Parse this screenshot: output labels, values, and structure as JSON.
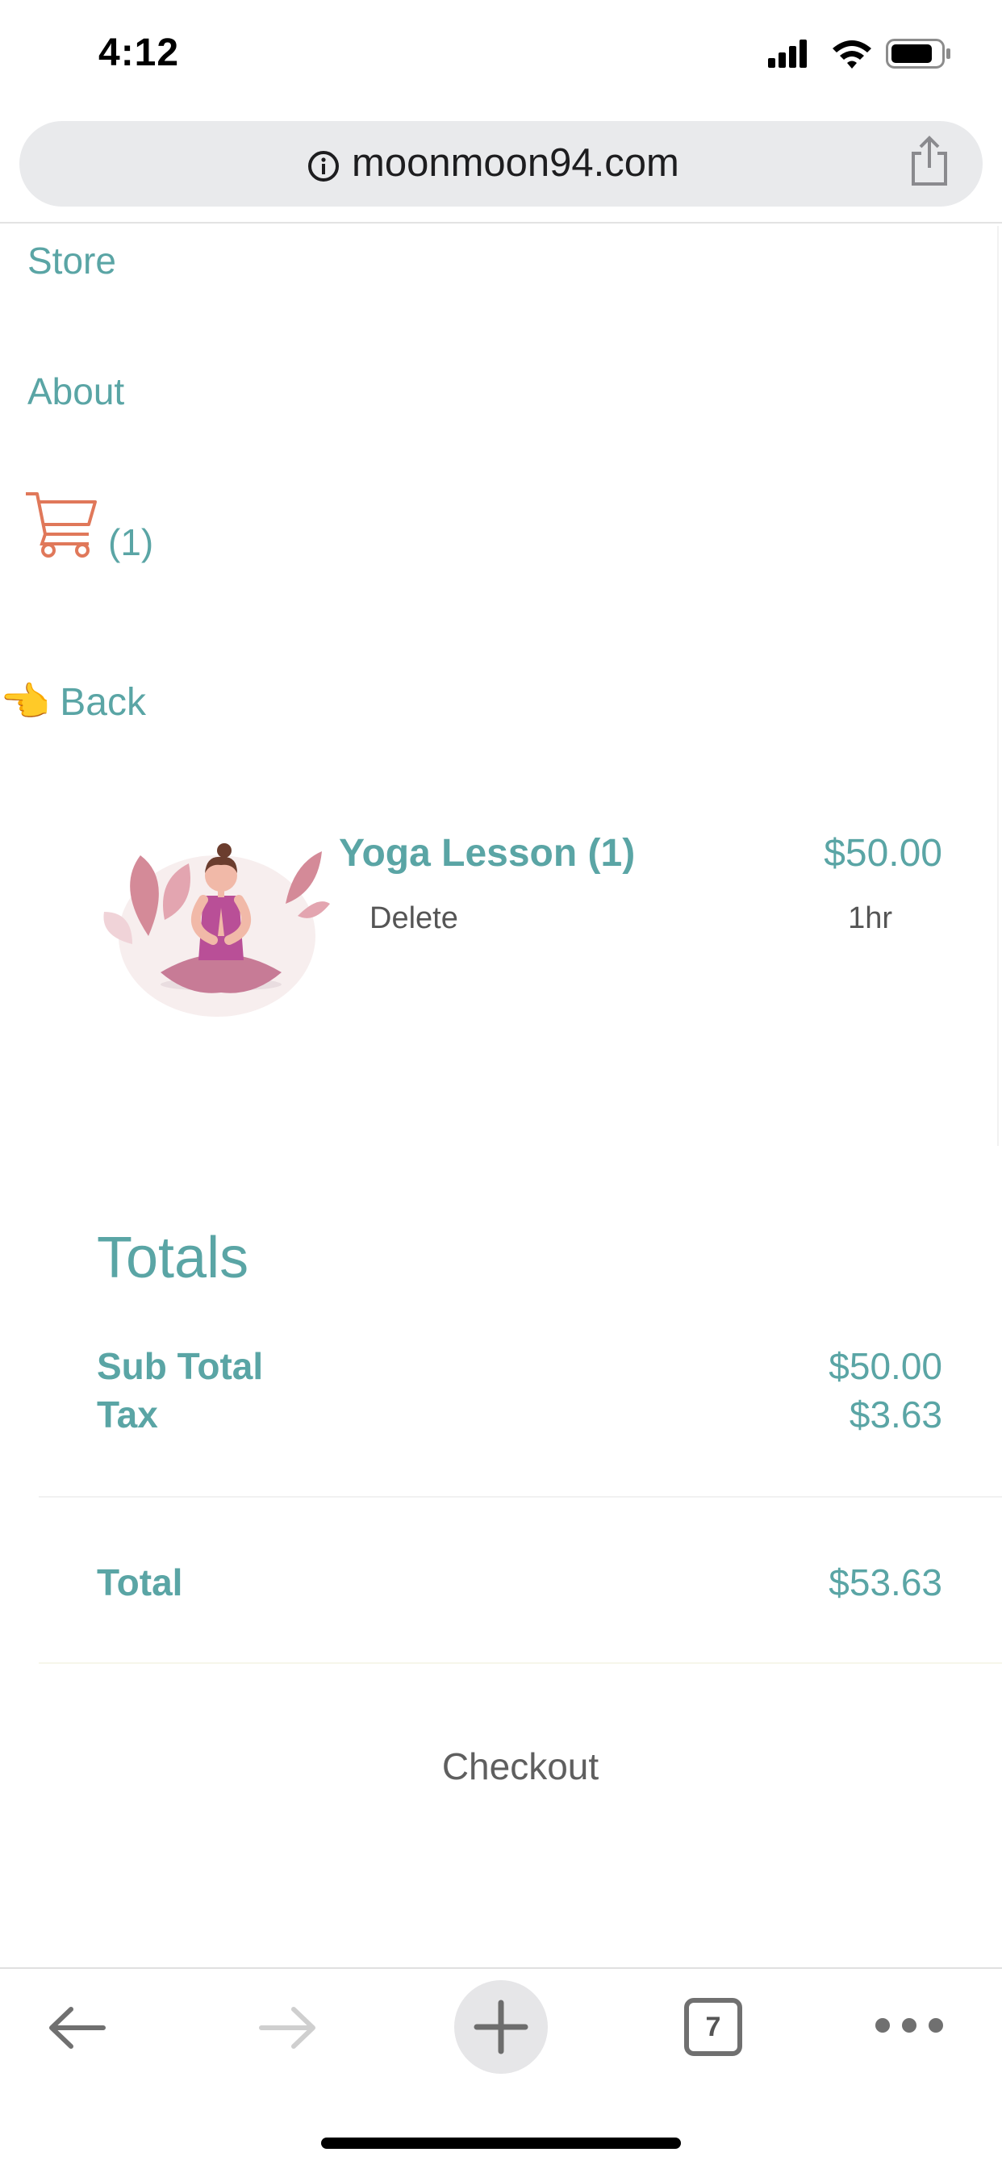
{
  "status_bar": {
    "time": "4:12",
    "icons": [
      "signal-icon",
      "wifi-icon",
      "battery-icon"
    ]
  },
  "browser": {
    "url": "moonmoon94.com",
    "tab_count": "7"
  },
  "nav": {
    "store": "Store",
    "about": "About",
    "cart_count": "(1)",
    "back": "Back",
    "back_emoji": "👈"
  },
  "cart_item": {
    "name": "Yoga Lesson (1)",
    "price": "$50.00",
    "delete": "Delete",
    "duration": "1hr"
  },
  "totals": {
    "heading": "Totals",
    "subtotal_label": "Sub Total",
    "subtotal_value": "$50.00",
    "tax_label": "Tax",
    "tax_value": "$3.63",
    "total_label": "Total",
    "total_value": "$53.63"
  },
  "checkout_label": "Checkout",
  "colors": {
    "accent": "#5aa5a5",
    "cart": "#e0785a",
    "address_bar": "#e9eaec"
  }
}
